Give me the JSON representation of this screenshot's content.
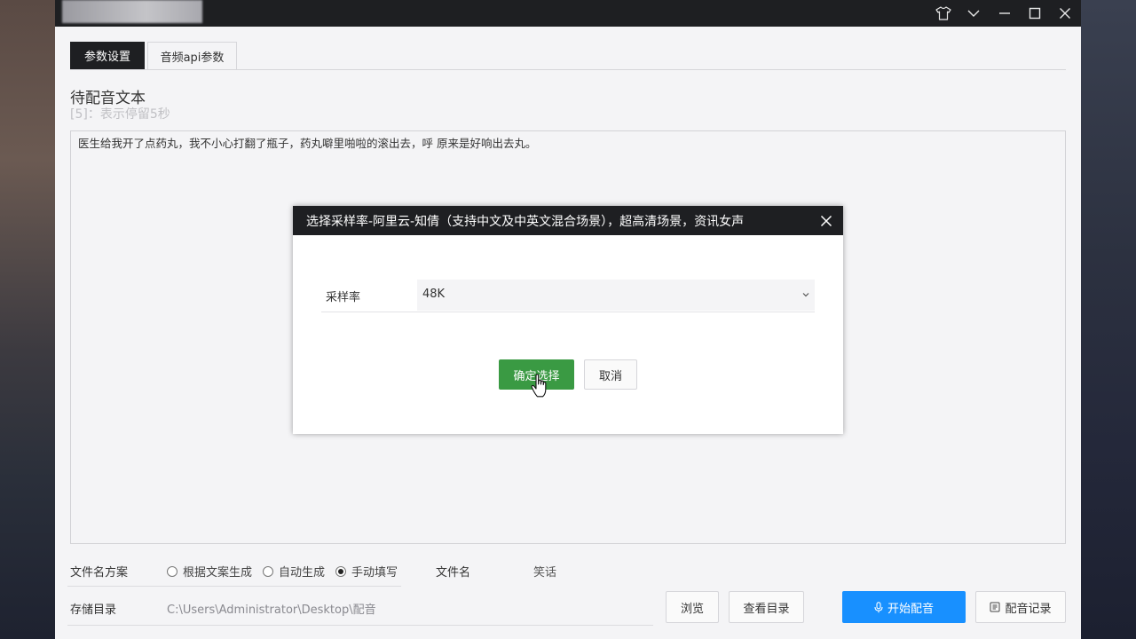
{
  "titlebar": {
    "icons": [
      "shirt-icon",
      "chevron-down-icon",
      "minimize-icon",
      "maximize-icon",
      "close-icon"
    ]
  },
  "tabs": [
    {
      "label": "参数设置",
      "active": true
    },
    {
      "label": "音频api参数",
      "active": false
    }
  ],
  "text_section": {
    "title": "待配音文本",
    "hint": "[5]：表示停留5秒",
    "content": "医生给我开了点药丸，我不小心打翻了瓶子，药丸噼里啪啦的滚出去，呼 原来是好响出去丸。"
  },
  "filename_scheme": {
    "label": "文件名方案",
    "options": [
      {
        "label": "根据文案生成",
        "selected": false
      },
      {
        "label": "自动生成",
        "selected": false
      },
      {
        "label": "手动填写",
        "selected": true
      }
    ]
  },
  "filename": {
    "label": "文件名",
    "value": "笑话"
  },
  "storage": {
    "label": "存储目录",
    "path": "C:\\Users\\Administrator\\Desktop\\配音",
    "browse_label": "浏览",
    "view_dir_label": "查看目录"
  },
  "actions": {
    "start_label": "开始配音",
    "history_label": "配音记录"
  },
  "dialog": {
    "title": "选择采样率-阿里云-知倩（支持中文及中英文混合场景），超高清场景，资讯女声",
    "field_label": "采样率",
    "selected_value": "48K",
    "confirm_label": "确定选择",
    "cancel_label": "取消"
  },
  "colors": {
    "titlebar_bg": "#1e1f22",
    "primary": "#1890ff",
    "confirm": "#3a9a43",
    "window_bg": "#f4f4f6"
  }
}
